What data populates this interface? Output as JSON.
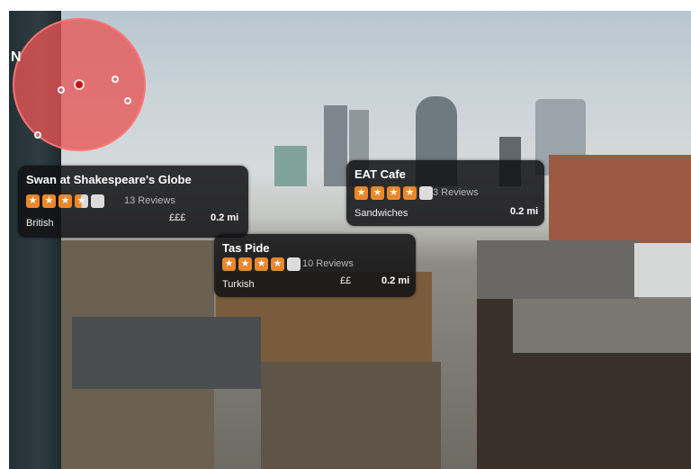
{
  "compass": {
    "north_label": "N"
  },
  "places": [
    {
      "name": "Swan at Shakespeare's Globe",
      "reviews": "13 Reviews",
      "cuisine": "British",
      "price": "£££",
      "distance": "0.2 mi",
      "rating": 3.5
    },
    {
      "name": "EAT Cafe",
      "reviews": "3 Reviews",
      "cuisine": "Sandwiches",
      "price": "",
      "distance": "0.2 mi",
      "rating": 4
    },
    {
      "name": "Tas Pide",
      "reviews": "10 Reviews",
      "cuisine": "Turkish",
      "price": "££",
      "distance": "0.2 mi",
      "rating": 4
    }
  ],
  "colors": {
    "star": "#e8882a",
    "radar": "#e85555",
    "card_bg": "#121214"
  }
}
